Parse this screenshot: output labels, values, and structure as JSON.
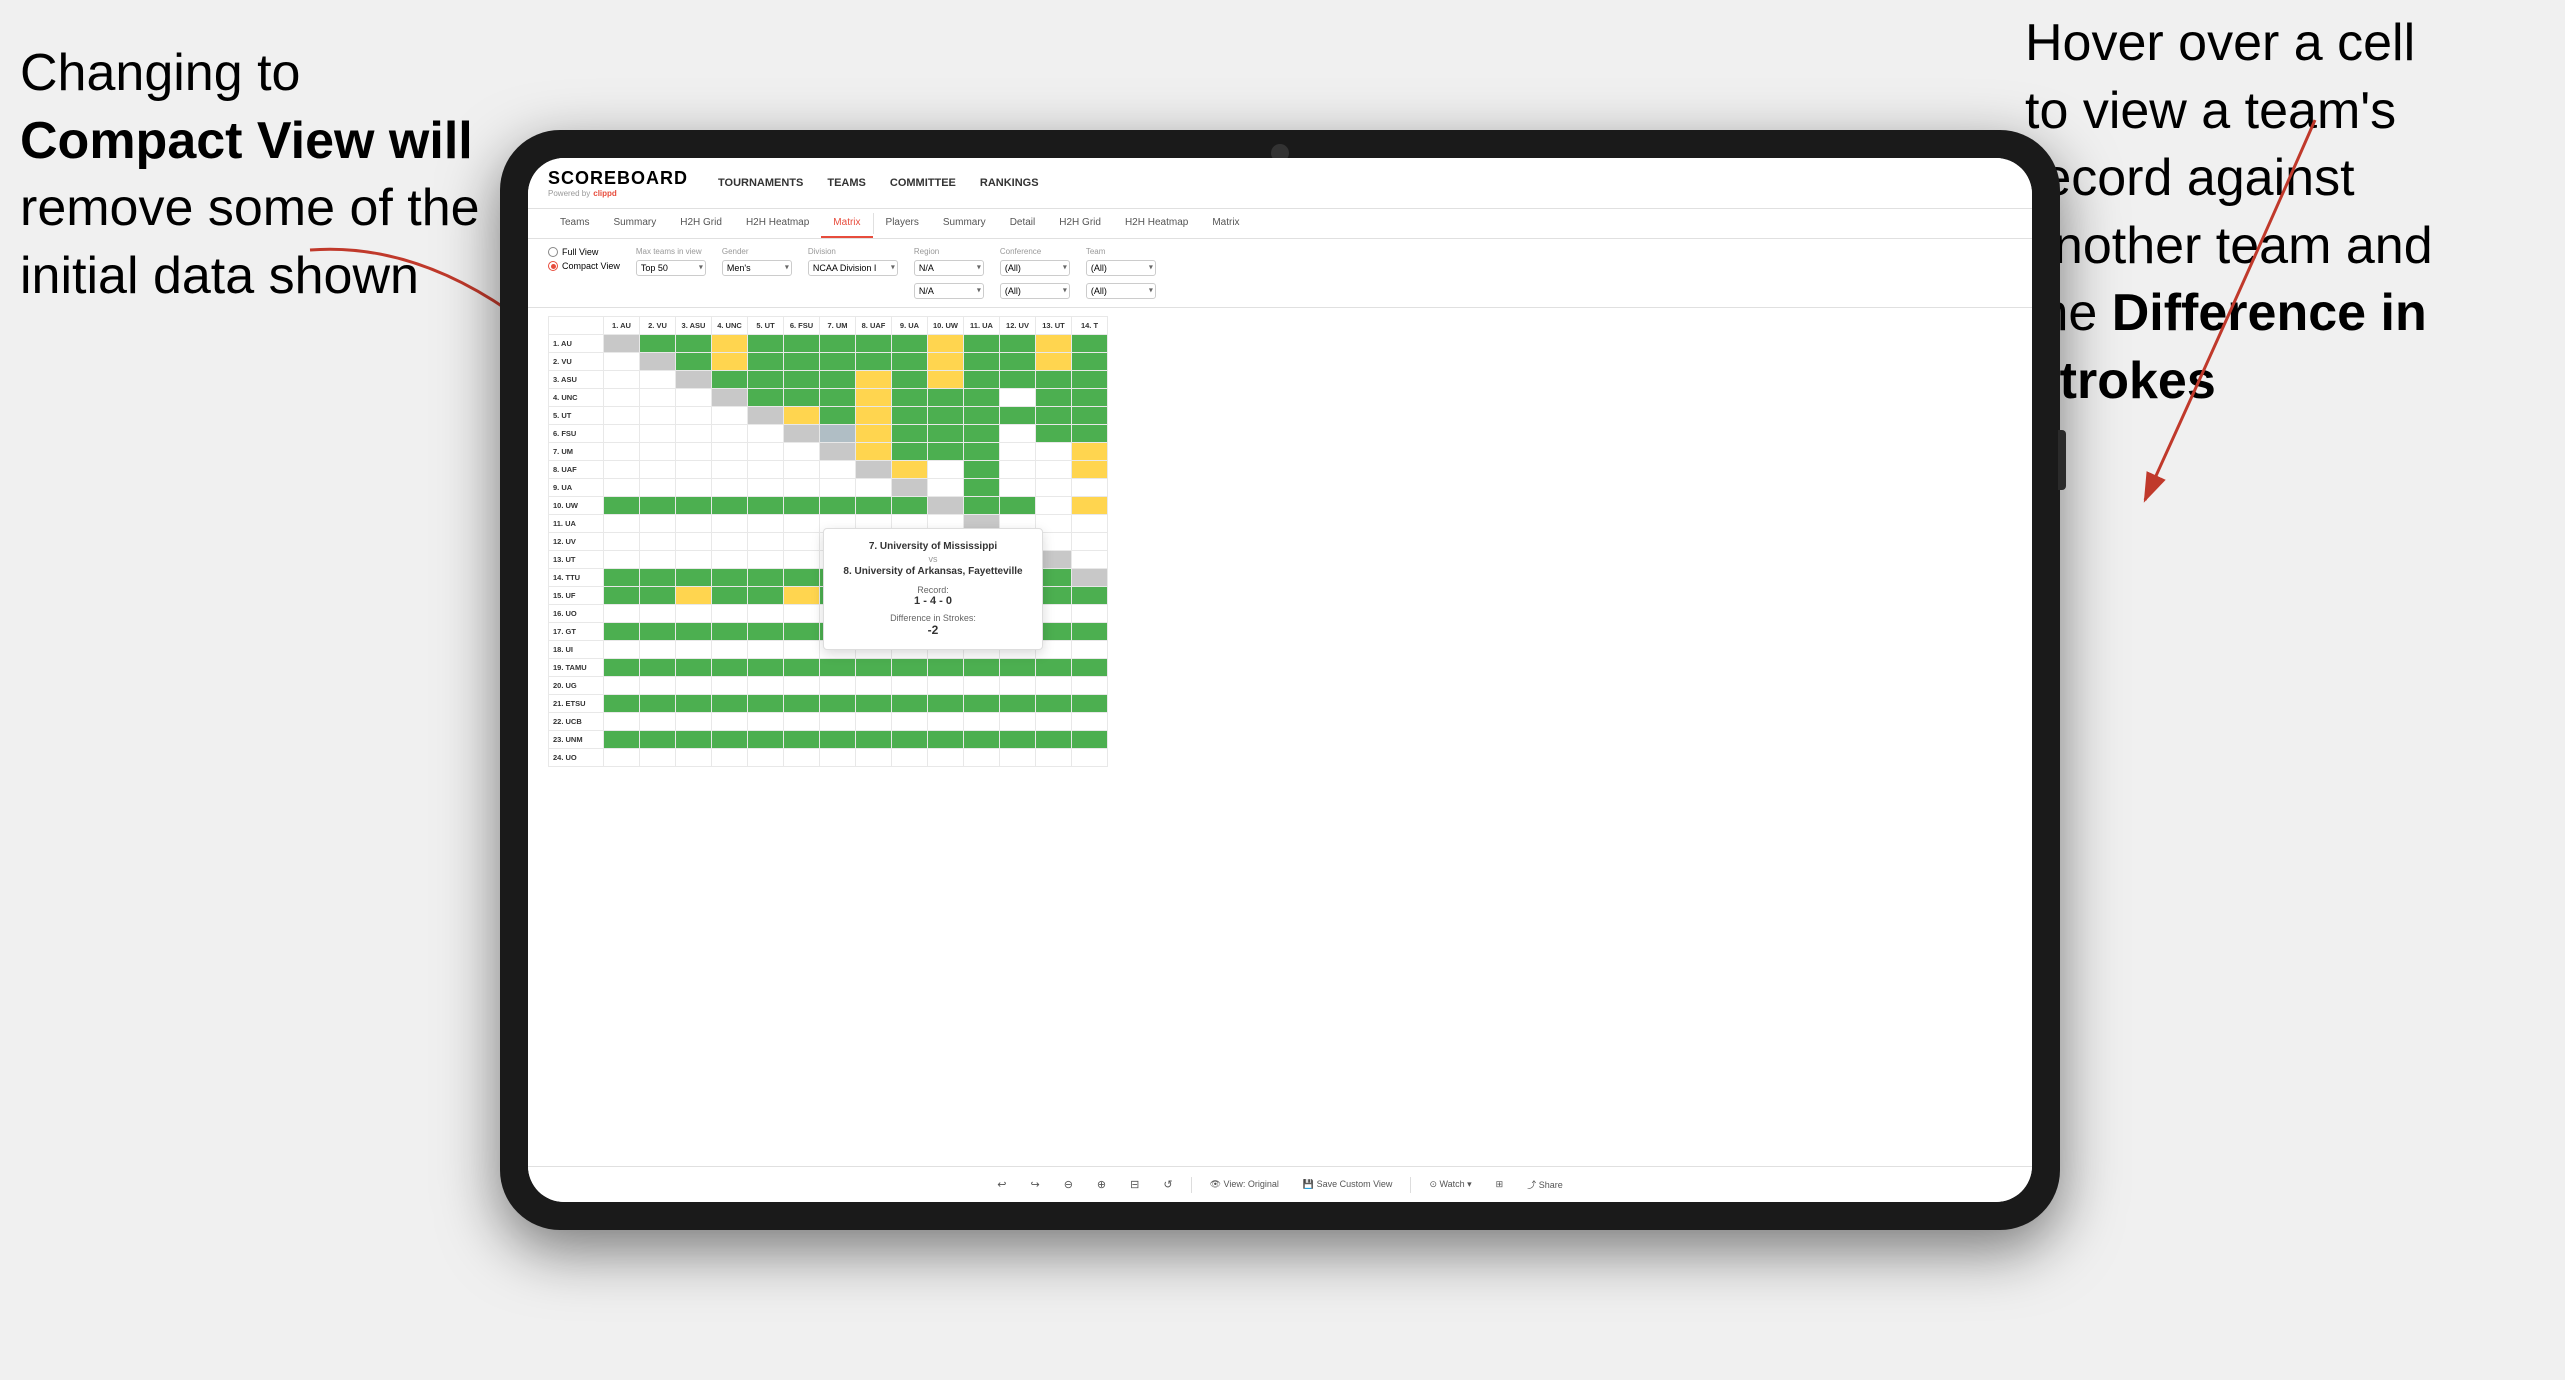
{
  "annotation_left": {
    "line1": "Changing to",
    "line2_bold": "Compact View will",
    "line3": "remove some of the",
    "line4": "initial data shown"
  },
  "annotation_right": {
    "line1": "Hover over a cell",
    "line2": "to view a team's",
    "line3": "record against",
    "line4": "another team and",
    "line5_pre": "the ",
    "line5_bold": "Difference in",
    "line6_bold": "Strokes"
  },
  "app": {
    "logo": "SCOREBOARD",
    "logo_sub": "Powered by clippd",
    "nav": [
      "TOURNAMENTS",
      "TEAMS",
      "COMMITTEE",
      "RANKINGS"
    ],
    "sub_nav_left": [
      "Teams",
      "Summary",
      "H2H Grid",
      "H2H Heatmap",
      "Matrix"
    ],
    "sub_nav_right": [
      "Players",
      "Summary",
      "Detail",
      "H2H Grid",
      "H2H Heatmap",
      "Matrix"
    ],
    "active_tab": "Matrix"
  },
  "controls": {
    "view_options": [
      "Full View",
      "Compact View"
    ],
    "selected_view": "Compact View",
    "filters": [
      {
        "label": "Max teams in view",
        "value": "Top 50"
      },
      {
        "label": "Gender",
        "value": "Men's"
      },
      {
        "label": "Division",
        "value": "NCAA Division I"
      },
      {
        "label": "Region",
        "value": "N/A"
      },
      {
        "label": "Conference",
        "value": "(All)"
      },
      {
        "label": "Team",
        "value": "(All)"
      }
    ]
  },
  "matrix": {
    "col_headers": [
      "1. AU",
      "2. VU",
      "3. ASU",
      "4. UNC",
      "5. UT",
      "6. FSU",
      "7. UM",
      "8. UAF",
      "9. UA",
      "10. UW",
      "11. UA",
      "12. UV",
      "13. UT",
      "14. T"
    ],
    "rows": [
      {
        "label": "1. AU",
        "cells": [
          "diag",
          "green",
          "green",
          "yellow",
          "green",
          "green",
          "green",
          "green",
          "green",
          "green",
          "green",
          "green",
          "yellow",
          "green"
        ]
      },
      {
        "label": "2. VU",
        "cells": [
          "white",
          "diag",
          "green",
          "yellow",
          "green",
          "green",
          "green",
          "green",
          "green",
          "green",
          "green",
          "green",
          "yellow",
          "green"
        ]
      },
      {
        "label": "3. ASU",
        "cells": [
          "white",
          "white",
          "diag",
          "green",
          "green",
          "green",
          "green",
          "yellow",
          "green",
          "green",
          "green",
          "green",
          "green",
          "green"
        ]
      },
      {
        "label": "4. UNC",
        "cells": [
          "white",
          "white",
          "white",
          "diag",
          "green",
          "green",
          "green",
          "yellow",
          "green",
          "green",
          "green",
          "white",
          "green",
          "green"
        ]
      },
      {
        "label": "5. UT",
        "cells": [
          "white",
          "white",
          "white",
          "white",
          "diag",
          "yellow",
          "green",
          "yellow",
          "green",
          "green",
          "green",
          "green",
          "green",
          "green"
        ]
      },
      {
        "label": "6. FSU",
        "cells": [
          "white",
          "white",
          "white",
          "white",
          "white",
          "diag",
          "gray",
          "yellow",
          "green",
          "green",
          "green",
          "white",
          "green",
          "green"
        ]
      },
      {
        "label": "7. UM",
        "cells": [
          "white",
          "white",
          "white",
          "white",
          "white",
          "white",
          "diag",
          "yellow",
          "green",
          "green",
          "green",
          "white",
          "white",
          "yellow"
        ]
      },
      {
        "label": "8. UAF",
        "cells": [
          "white",
          "white",
          "white",
          "white",
          "white",
          "white",
          "white",
          "diag",
          "yellow",
          "white",
          "green",
          "white",
          "white",
          "yellow"
        ]
      },
      {
        "label": "9. UA",
        "cells": [
          "white",
          "white",
          "white",
          "white",
          "white",
          "white",
          "white",
          "white",
          "diag",
          "white",
          "green",
          "white",
          "white",
          "white"
        ]
      },
      {
        "label": "10. UW",
        "cells": [
          "green",
          "green",
          "green",
          "green",
          "green",
          "green",
          "green",
          "green",
          "green",
          "diag",
          "green",
          "green",
          "white",
          "yellow"
        ]
      },
      {
        "label": "11. UA",
        "cells": [
          "white",
          "white",
          "white",
          "white",
          "white",
          "white",
          "white",
          "white",
          "white",
          "white",
          "diag",
          "white",
          "white",
          "white"
        ]
      },
      {
        "label": "12. UV",
        "cells": [
          "white",
          "white",
          "white",
          "white",
          "white",
          "white",
          "white",
          "white",
          "white",
          "white",
          "white",
          "diag",
          "white",
          "white"
        ]
      },
      {
        "label": "13. UT",
        "cells": [
          "white",
          "white",
          "white",
          "white",
          "white",
          "white",
          "white",
          "white",
          "white",
          "white",
          "white",
          "white",
          "diag",
          "white"
        ]
      },
      {
        "label": "14. TTU",
        "cells": [
          "green",
          "green",
          "green",
          "green",
          "green",
          "green",
          "green",
          "green",
          "green",
          "green",
          "green",
          "green",
          "green",
          "diag"
        ]
      },
      {
        "label": "15. UF",
        "cells": [
          "green",
          "green",
          "yellow",
          "green",
          "green",
          "yellow",
          "green",
          "green",
          "green",
          "green",
          "green",
          "green",
          "green",
          "green"
        ]
      },
      {
        "label": "16. UO",
        "cells": [
          "white",
          "white",
          "white",
          "white",
          "white",
          "white",
          "white",
          "white",
          "white",
          "white",
          "white",
          "white",
          "white",
          "white"
        ]
      },
      {
        "label": "17. GT",
        "cells": [
          "green",
          "green",
          "green",
          "green",
          "green",
          "green",
          "green",
          "green",
          "green",
          "green",
          "green",
          "green",
          "green",
          "green"
        ]
      },
      {
        "label": "18. UI",
        "cells": [
          "white",
          "white",
          "white",
          "white",
          "white",
          "white",
          "white",
          "white",
          "white",
          "white",
          "white",
          "white",
          "white",
          "white"
        ]
      },
      {
        "label": "19. TAMU",
        "cells": [
          "green",
          "green",
          "green",
          "green",
          "green",
          "green",
          "green",
          "green",
          "green",
          "green",
          "green",
          "green",
          "green",
          "green"
        ]
      },
      {
        "label": "20. UG",
        "cells": [
          "white",
          "white",
          "white",
          "white",
          "white",
          "white",
          "white",
          "white",
          "white",
          "white",
          "white",
          "white",
          "white",
          "white"
        ]
      },
      {
        "label": "21. ETSU",
        "cells": [
          "green",
          "green",
          "green",
          "green",
          "green",
          "green",
          "green",
          "green",
          "green",
          "green",
          "green",
          "green",
          "green",
          "green"
        ]
      },
      {
        "label": "22. UCB",
        "cells": [
          "white",
          "white",
          "white",
          "white",
          "white",
          "white",
          "white",
          "white",
          "white",
          "white",
          "white",
          "white",
          "white",
          "white"
        ]
      },
      {
        "label": "23. UNM",
        "cells": [
          "green",
          "green",
          "green",
          "green",
          "green",
          "green",
          "green",
          "green",
          "green",
          "green",
          "green",
          "green",
          "green",
          "green"
        ]
      },
      {
        "label": "24. UO",
        "cells": [
          "white",
          "white",
          "white",
          "white",
          "white",
          "white",
          "white",
          "white",
          "white",
          "white",
          "white",
          "white",
          "white",
          "white"
        ]
      }
    ]
  },
  "tooltip": {
    "team1": "7. University of Mississippi",
    "vs": "vs",
    "team2": "8. University of Arkansas, Fayetteville",
    "record_label": "Record:",
    "record_value": "1 - 4 - 0",
    "strokes_label": "Difference in Strokes:",
    "strokes_value": "-2"
  },
  "toolbar": {
    "buttons": [
      "↩",
      "↪",
      "⊖",
      "⊕",
      "⊟",
      "↺",
      "View: Original",
      "Save Custom View",
      "Watch ▾",
      "⊞",
      "Share"
    ]
  }
}
